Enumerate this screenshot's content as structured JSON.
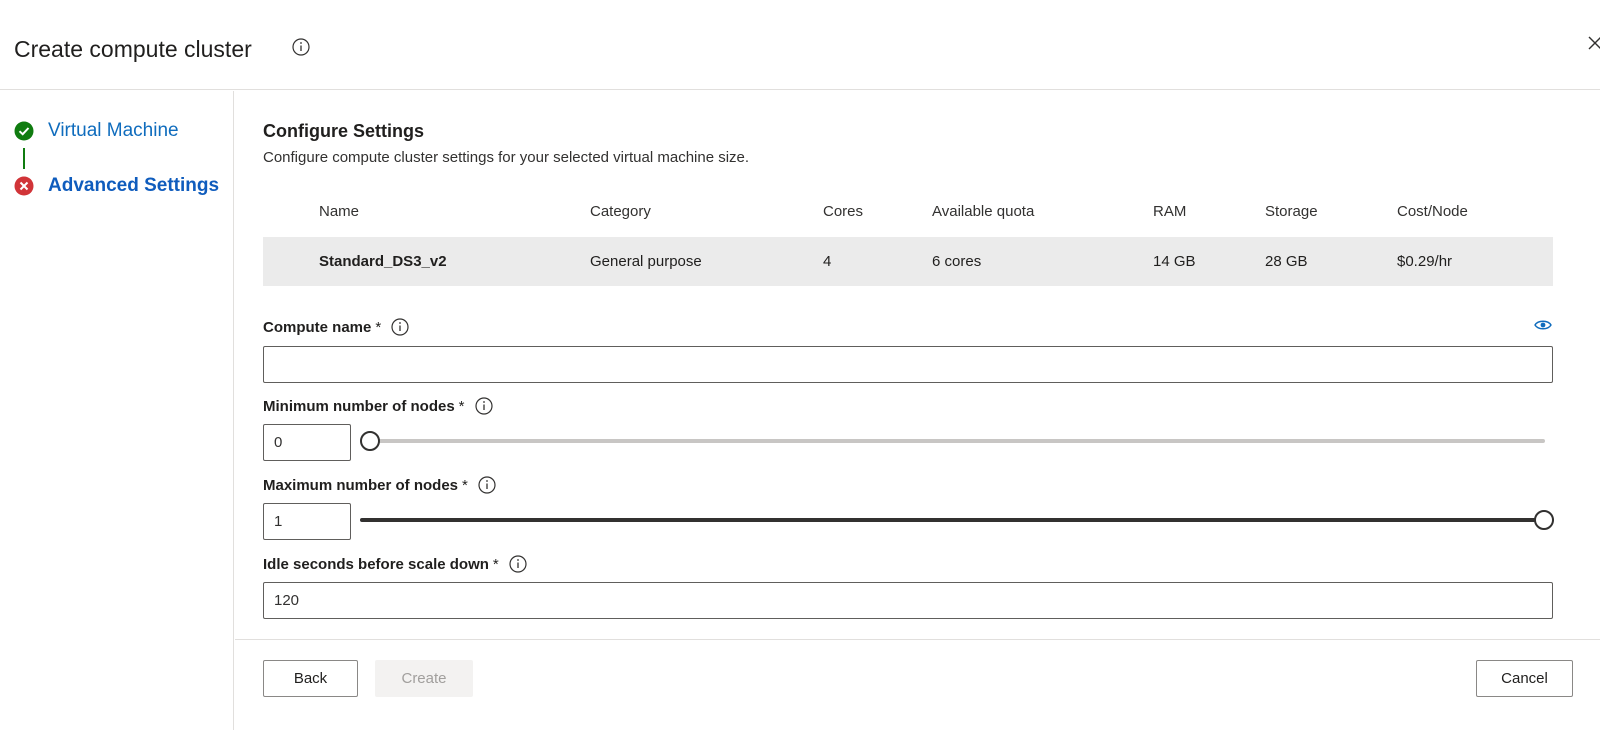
{
  "header": {
    "title": "Create compute cluster"
  },
  "stepper": {
    "steps": [
      {
        "label": "Virtual Machine",
        "status": "complete",
        "icon": "check-circle-icon",
        "color": "#107c10"
      },
      {
        "label": "Advanced Settings",
        "status": "error",
        "icon": "error-circle-icon",
        "color": "#d13438"
      }
    ]
  },
  "section": {
    "title": "Configure Settings",
    "description": "Configure compute cluster settings for your selected virtual machine size."
  },
  "vm_table": {
    "columns": [
      "Name",
      "Category",
      "Cores",
      "Available quota",
      "RAM",
      "Storage",
      "Cost/Node"
    ],
    "row": {
      "name": "Standard_DS3_v2",
      "category": "General purpose",
      "cores": "4",
      "quota": "6 cores",
      "ram": "14 GB",
      "storage": "28 GB",
      "cost": "$0.29/hr"
    }
  },
  "fields": {
    "compute_name": {
      "label": "Compute name",
      "required": "*",
      "value": ""
    },
    "min_nodes": {
      "label": "Minimum number of nodes",
      "required": "*",
      "value": "0",
      "slider_fraction": 0
    },
    "max_nodes": {
      "label": "Maximum number of nodes",
      "required": "*",
      "value": "1",
      "slider_fraction": 1
    },
    "idle_seconds": {
      "label": "Idle seconds before scale down",
      "required": "*",
      "value": "120"
    }
  },
  "footer": {
    "back_label": "Back",
    "create_label": "Create",
    "cancel_label": "Cancel"
  },
  "colors": {
    "accent": "#0f6cbd",
    "success": "#107c10",
    "error": "#d13438",
    "slider_filled": "#323130",
    "slider_empty": "#c8c6c4"
  }
}
